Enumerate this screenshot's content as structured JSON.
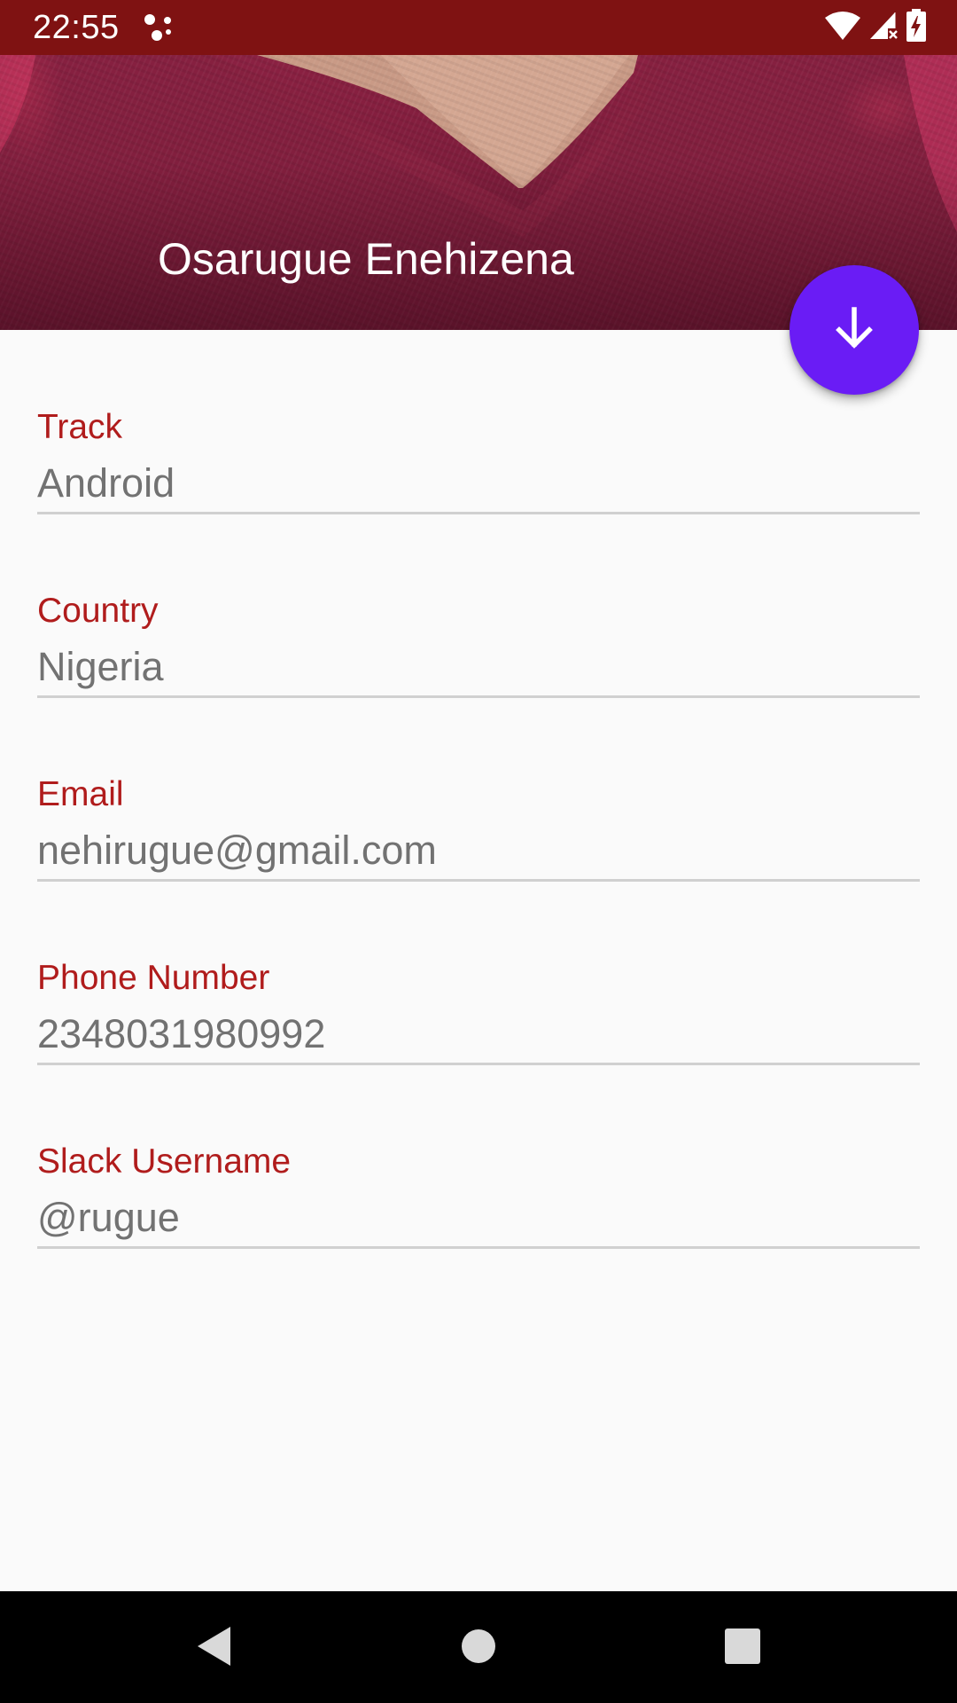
{
  "status_bar": {
    "time": "22:55",
    "background": "#7f1212",
    "icons": [
      "notification-dots-icon",
      "wifi-icon",
      "cell-signal-icon",
      "battery-charging-icon"
    ]
  },
  "header": {
    "name": "Osarugue Enehizena"
  },
  "fab": {
    "icon": "arrow-down-icon",
    "color": "#6a1cf5"
  },
  "details": {
    "items": [
      {
        "label": "Track",
        "value": "Android"
      },
      {
        "label": "Country",
        "value": "Nigeria"
      },
      {
        "label": "Email",
        "value": "nehirugue@gmail.com"
      },
      {
        "label": "Phone Number",
        "value": "2348031980992"
      },
      {
        "label": "Slack Username",
        "value": "@rugue"
      }
    ],
    "label_color": "#b01c1c",
    "value_color": "#727272"
  },
  "nav_bar": {
    "buttons": [
      "back-icon",
      "home-icon",
      "recents-icon"
    ]
  }
}
